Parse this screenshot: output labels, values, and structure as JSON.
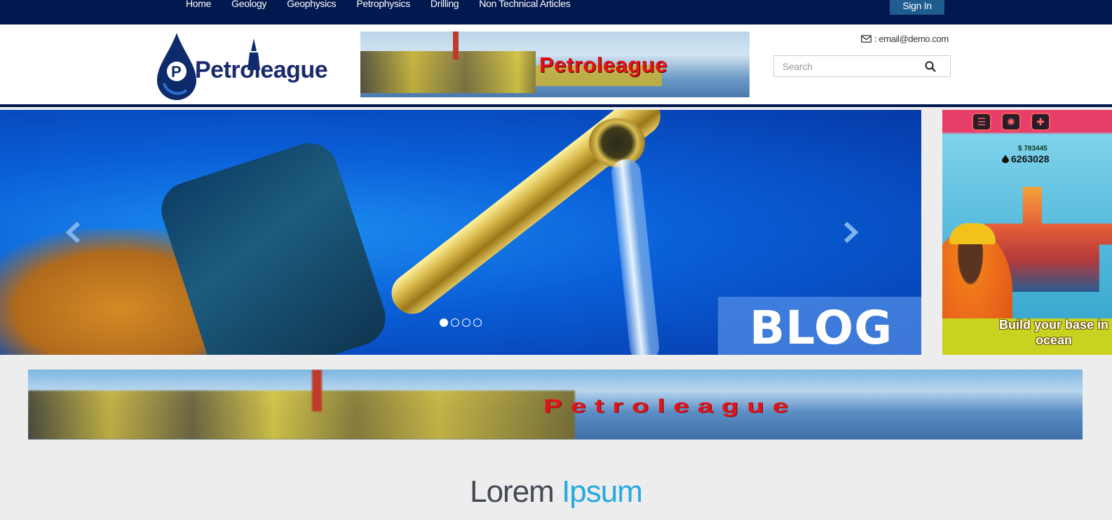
{
  "nav": {
    "items": [
      "Home",
      "Geology",
      "Geophysics",
      "Petrophysics",
      "Drilling",
      "Non Technical Articles"
    ],
    "signin_label": "Sign In"
  },
  "header": {
    "logo_text": "Petroleague",
    "banner_brand": "Petroleague",
    "email": ": email@demo.com",
    "search_placeholder": "Search"
  },
  "carousel": {
    "overlay_label": "BLOG",
    "slide_count": 4,
    "active_index": 0
  },
  "side_ad": {
    "money": "$ 783445",
    "oil_count": "6263028",
    "cta": "Build your base in ocean"
  },
  "wide_banner": {
    "brand": "Petroleague"
  },
  "section": {
    "title_part1": "Lorem",
    "title_part2": "Ipsum"
  },
  "colors": {
    "nav_bg": "#021950",
    "accent": "#27a9e1",
    "brand_red": "#e2141a",
    "signin_bg": "#1f5c8f"
  }
}
